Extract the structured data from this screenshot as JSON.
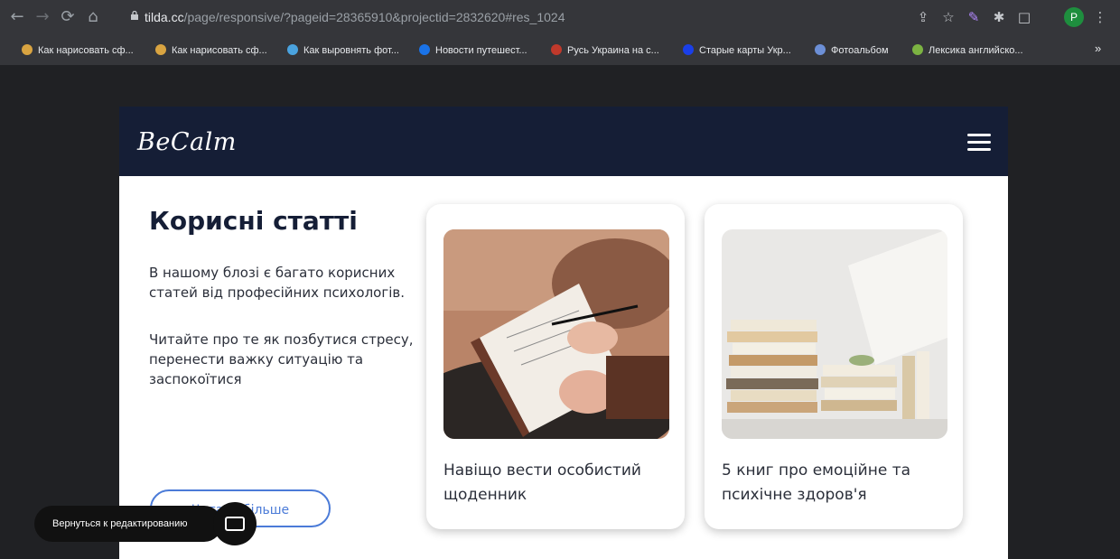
{
  "browser": {
    "url_host": "tilda.cc",
    "url_path": "/page/responsive/?pageid=28365910&projectid=2832620#res_1024",
    "profile_letter": "P",
    "bookmarks": [
      {
        "label": "Как нарисовать сф...",
        "color": "#d9a441"
      },
      {
        "label": "Как нарисовать сф...",
        "color": "#d9a441"
      },
      {
        "label": "Как выровнять фот...",
        "color": "#4aa3df"
      },
      {
        "label": "Новости путешест...",
        "color": "#1a73e8"
      },
      {
        "label": "Русь Украина на с...",
        "color": "#c0392b"
      },
      {
        "label": "Старые карты Укр...",
        "color": "#1a3fe8"
      },
      {
        "label": "Фотоальбом",
        "color": "#6c8fd6"
      },
      {
        "label": "Лексика английско...",
        "color": "#7cb342"
      }
    ],
    "bookmarks_more": "»"
  },
  "site": {
    "logo": "BeCalm",
    "heading": "Корисні статті",
    "para1": "В нашому блозі є багато корисних статей від професійних психологів.",
    "para2": "Читайте про те як позбутися стресу, перенести важку ситуацію та заспокоїтися",
    "more_button": "Читати більше",
    "cards": [
      {
        "title": "Навіщо вести особистий щоденник"
      },
      {
        "title": "5 книг про емоційне та психічне здоров'я"
      }
    ]
  },
  "editor": {
    "back_label": "Вернуться к редактированию"
  },
  "colors": {
    "header_bg": "#151e36",
    "accent": "#4b7bd8"
  }
}
